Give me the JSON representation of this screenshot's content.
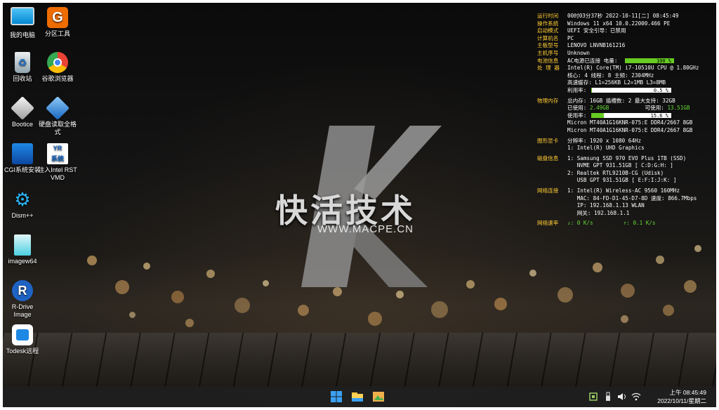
{
  "desktop": {
    "icons": [
      {
        "label": "我的电脑",
        "icon": "computer-icon"
      },
      {
        "label": "分区工具",
        "icon": "partition-tool-icon"
      },
      {
        "label": "回收站",
        "icon": "recycle-bin-icon"
      },
      {
        "label": "谷歌浏览器",
        "icon": "chrome-icon"
      },
      {
        "label": "Bootice",
        "icon": "bootice-icon"
      },
      {
        "label": "硬盘读取全格式",
        "icon": "disk-reader-icon"
      },
      {
        "label": "CGI系统安装",
        "icon": "cgi-installer-icon"
      },
      {
        "label": "注入Intel RST VMD",
        "icon": "intel-rst-icon"
      },
      {
        "label": "Dism++",
        "icon": "dism-icon"
      },
      {
        "label": "imagew64",
        "icon": "imagew-icon"
      },
      {
        "label": "R-Drive Image",
        "icon": "rdrive-icon"
      },
      {
        "label": "Todesk远程",
        "icon": "todesk-icon"
      }
    ]
  },
  "wallpaper": {
    "brand_text": "快活技术",
    "url_text": "WWW.MACPE.CN"
  },
  "sysinfo": {
    "runtime": {
      "label": "运行时间",
      "value": "00时03分37秒 2022-10-11[二] 08:45:49"
    },
    "os": {
      "label": "操作系统",
      "value": "Windows 11 x64  10.0.22000.466 PE"
    },
    "boot": {
      "label": "启动模式",
      "value": "UEFI  安全引导：已禁用"
    },
    "pcname": {
      "label": "计算机名",
      "value": "PC"
    },
    "board": {
      "label": "主板型号",
      "value": "LENOVO LNVNB161216"
    },
    "serial": {
      "label": "主机序号",
      "value": "Unknown"
    },
    "battery": {
      "label": "电池信息",
      "value": "AC电源已连接  电量:",
      "bar_text": "100 %",
      "level": 1.0
    },
    "cpu": {
      "label": "处 理 器",
      "model": "Intel(R) Core(TM) i7-10510U CPU @ 1.80GHz",
      "cores": "核心: 4  线程: 8        主频: 2304MHz",
      "cache": "高速缓存: L1=256KB L2=1MB L3=8MB",
      "usage_label": "利用率:",
      "usage_text": "0.5 %",
      "usage": 0.005
    },
    "memory": {
      "label": "物理内存",
      "total": "总内存: 16GB 插槽数: 2 最大支持: 32GB",
      "used_label": "已使用:",
      "used": "2.49GB",
      "avail_label": "可使用:",
      "avail": "13.51GB",
      "usage_label": "使用率:",
      "usage_text": "15.6 %",
      "usage": 0.156,
      "dimm1": "Micron MT40A1G16KNR-075:E DDR4/2667 8GB",
      "dimm2": "Micron MT40A1G16KNR-075:E DDR4/2667 8GB"
    },
    "gpu": {
      "label": "图形显卡",
      "resolution": "分辨率: 1920 x 1080 64Hz",
      "adapter": "1: Intel(R) UHD Graphics"
    },
    "disk": {
      "label": "磁盘信息",
      "d1": "1: Samsung SSD 970 EVO Plus 1TB (SSD)",
      "d1b": "   NVME GPT 931.51GB [ C:D:G:H: ]",
      "d2": "2: Realtek RTL9210B-CG (Udisk)",
      "d2b": "   USB GPT 931.51GB [ E:F:I:J:K: ]"
    },
    "network": {
      "label": "网络连接",
      "n1": "1: Intel(R) Wireless-AC 9560 160MHz",
      "n2": "   MAC: 84-FD-D1-45-D7-8D 速度: 866.7Mbps",
      "n3": "   IP: 192.168.1.13 WLAN",
      "n4": "   网关: 192.168.1.1"
    },
    "speed": {
      "label": "网络速率",
      "down": "↓: 0 K/s",
      "up": "↑: 0.1 K/s"
    }
  },
  "taskbar": {
    "time": "上午 08:45:49",
    "date": "2022/10/11/星期二",
    "buttons": [
      "windows-start-icon",
      "file-explorer-icon",
      "image-tool-icon"
    ],
    "tray": [
      "device-icon",
      "usb-icon",
      "speaker-icon",
      "wifi-icon"
    ]
  },
  "colors": {
    "label": "#ffcc33",
    "value": "#ffffff",
    "highlight": "#66dd33",
    "taskbar": "#1e1e20"
  }
}
